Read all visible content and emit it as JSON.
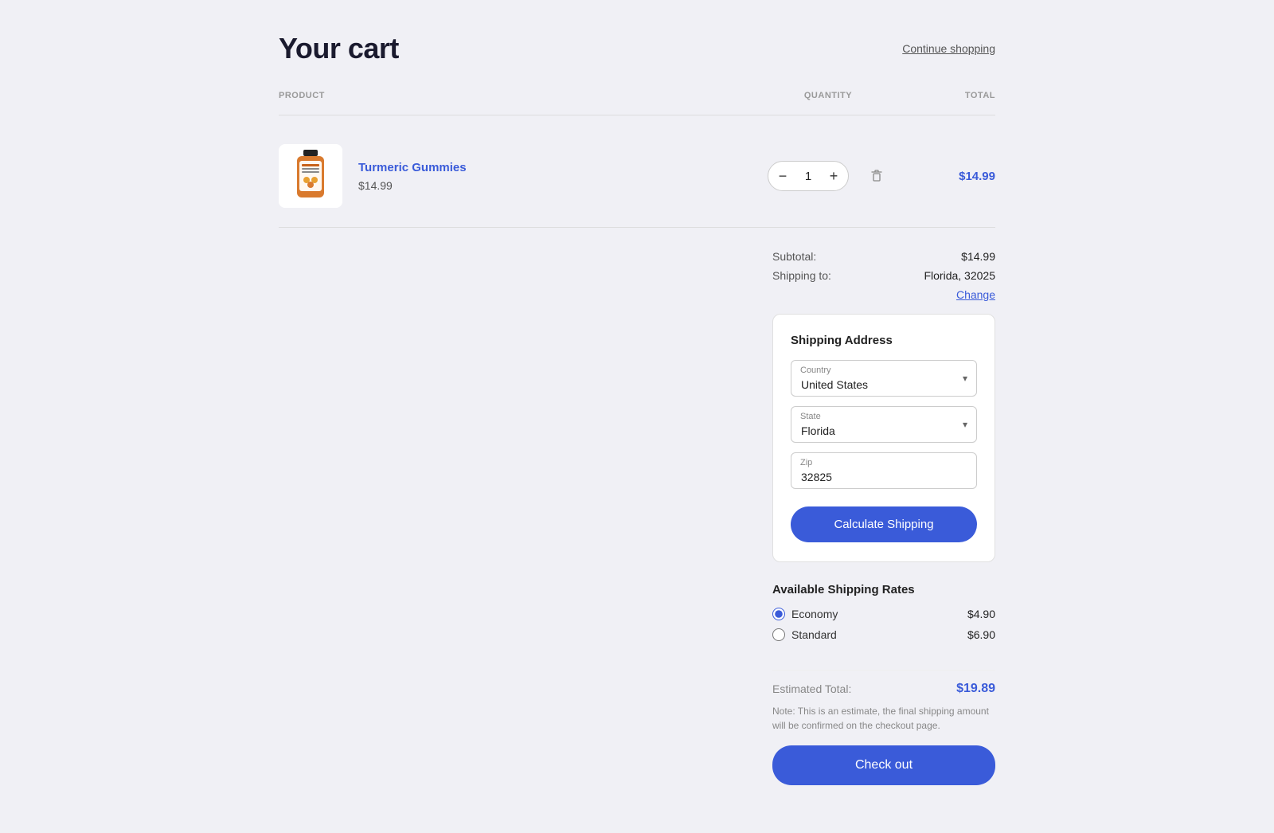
{
  "header": {
    "title": "Your cart",
    "continue_shopping_label": "Continue shopping"
  },
  "columns": {
    "product": "PRODUCT",
    "quantity": "QUANTITY",
    "total": "TOTAL"
  },
  "cart_item": {
    "name": "Turmeric Gummies",
    "price": "$14.99",
    "quantity": "1",
    "total": "$14.99"
  },
  "summary": {
    "subtotal_label": "Subtotal:",
    "subtotal_value": "$14.99",
    "shipping_to_label": "Shipping to:",
    "shipping_to_value": "Florida, 32025",
    "change_label": "Change"
  },
  "shipping_address": {
    "title": "Shipping Address",
    "country_label": "Country",
    "country_value": "United States",
    "state_label": "State",
    "state_value": "Florida",
    "zip_label": "Zip",
    "zip_value": "32825",
    "calculate_btn": "Calculate Shipping"
  },
  "available_rates": {
    "title": "Available Shipping Rates",
    "options": [
      {
        "name": "Economy",
        "price": "$4.90",
        "selected": true
      },
      {
        "name": "Standard",
        "price": "$6.90",
        "selected": false
      }
    ]
  },
  "estimated": {
    "label": "Estimated Total:",
    "value": "$19.89",
    "note": "Note: This is an estimate, the final shipping amount will be confirmed on the checkout page.",
    "checkout_btn": "Check out"
  }
}
